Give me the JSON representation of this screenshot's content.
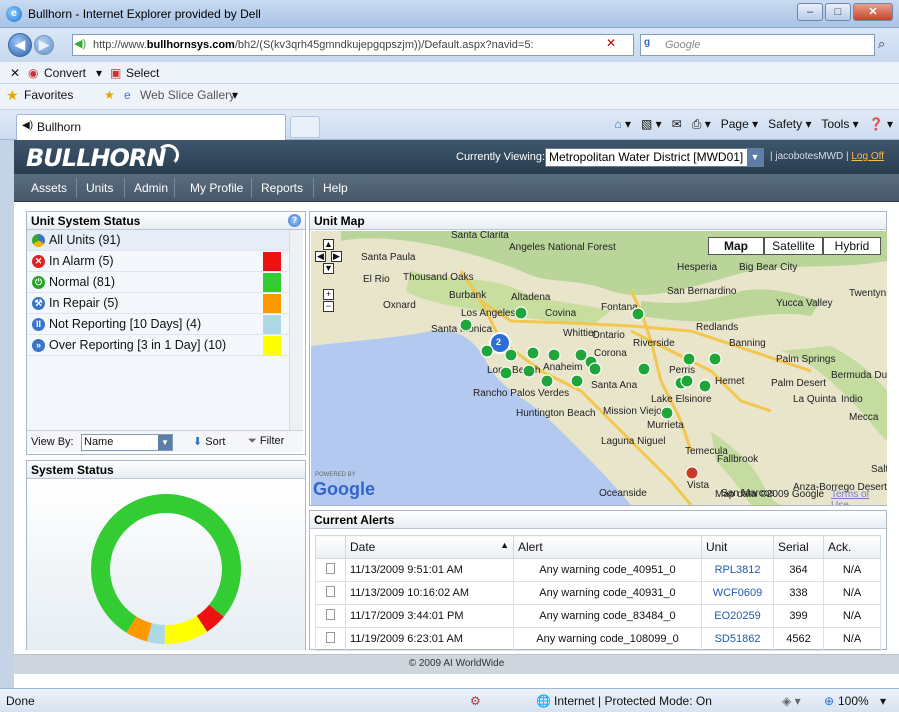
{
  "browser": {
    "title": "Bullhorn - Internet Explorer provided by Dell",
    "url_prefix": "http://www.",
    "url_domain": "bullhornsys.com",
    "url_rest": "/bh2/(S(kv3qrh45gmndkujepgqpszjm))/Default.aspx?navid=5:",
    "search_placeholder": "Google",
    "convert_label": "Convert",
    "select_label": "Select",
    "favorites_label": "Favorites",
    "webslice_label": "Web Slice Gallery",
    "tab_label": "Bullhorn",
    "cmd_page": "Page",
    "cmd_safety": "Safety",
    "cmd_tools": "Tools",
    "status_done": "Done",
    "status_zone": "Internet | Protected Mode: On",
    "zoom": "100%"
  },
  "app": {
    "logo": "BULLHORN",
    "viewing_label": "Currently Viewing:",
    "viewing_value": "Metropolitan Water District [MWD01]",
    "user": "jacobotesMWD",
    "logoff": "Log Off",
    "menu": [
      "Assets",
      "Units",
      "Admin",
      "My Profile",
      "Reports",
      "Help"
    ],
    "footer": "© 2009 AI WorldWide"
  },
  "unit_status": {
    "title": "Unit System Status",
    "rows": [
      {
        "label": "All Units (91)",
        "color": "",
        "icon": "all-units-icon"
      },
      {
        "label": "In Alarm (5)",
        "color": "#ee1111",
        "icon": "alarm-icon"
      },
      {
        "label": "Normal (81)",
        "color": "#33cc33",
        "icon": "power-icon"
      },
      {
        "label": "In Repair (5)",
        "color": "#ff9900",
        "icon": "wrench-icon"
      },
      {
        "label": "Not Reporting [10 Days] (4)",
        "color": "#add8e6",
        "icon": "pause-icon"
      },
      {
        "label": "Over Reporting [3 in 1 Day] (10)",
        "color": "#ffff00",
        "icon": "fast-forward-icon"
      }
    ],
    "view_by_label": "View By:",
    "view_by_value": "Name",
    "sort_label": "Sort",
    "filter_label": "Filter"
  },
  "system_status": {
    "title": "System Status",
    "donut": [
      {
        "name": "Normal",
        "value": 81,
        "color": "#33cc33"
      },
      {
        "name": "In Alarm",
        "value": 5,
        "color": "#ee1111"
      },
      {
        "name": "Over Reporting",
        "value": 10,
        "color": "#ffff00"
      },
      {
        "name": "Not Reporting",
        "value": 4,
        "color": "#add8e6"
      },
      {
        "name": "In Repair",
        "value": 5,
        "color": "#ff9900"
      }
    ]
  },
  "map": {
    "title": "Unit Map",
    "types": [
      "Map",
      "Satellite",
      "Hybrid"
    ],
    "copyright": "Map data ©2009 Google",
    "terms": "Terms of Use",
    "powered": "POWERED BY",
    "google": "Google",
    "cluster_count": "2",
    "places": [
      "Santa Clarita",
      "Angeles National Forest",
      "Hesperia",
      "Big Bear City",
      "Thousand Oaks",
      "El Rio",
      "Oxnard",
      "Burbank",
      "Los Angeles",
      "Altadena",
      "Covina",
      "Fontana",
      "San Bernardino",
      "Yucca Valley",
      "Twentynine Palms",
      "Redlands",
      "Santa Monica",
      "Whittier",
      "Ontario",
      "Riverside",
      "Banning",
      "Palm Springs",
      "Corona",
      "Anaheim",
      "Long Beach",
      "Santa Ana",
      "Perris",
      "Hemet",
      "Palm Desert",
      "Bermuda Dunes",
      "La Quinta",
      "Indio",
      "Rancho Palos Verdes",
      "Huntington Beach",
      "Mission Viejo",
      "Lake Elsinore",
      "Murrieta",
      "Mecca",
      "Laguna Niguel",
      "Temecula",
      "Fallbrook",
      "Oceanside",
      "Vista",
      "San Marcos",
      "Anza-Borrego Desert State",
      "Santa Paula",
      "Salton"
    ]
  },
  "alerts": {
    "title": "Current Alerts",
    "columns": [
      "Date",
      "Alert",
      "Unit",
      "Serial",
      "Ack."
    ],
    "rows": [
      {
        "date": "11/13/2009 9:51:01 AM",
        "alert": "Any warning code_40951_0",
        "unit": "RPL3812",
        "serial": "364",
        "ack": "N/A"
      },
      {
        "date": "11/13/2009 10:16:02 AM",
        "alert": "Any warning code_40931_0",
        "unit": "WCF0609",
        "serial": "338",
        "ack": "N/A"
      },
      {
        "date": "11/17/2009 3:44:01 PM",
        "alert": "Any warning code_83484_0",
        "unit": "EO20259",
        "serial": "399",
        "ack": "N/A"
      },
      {
        "date": "11/19/2009 6:23:01 AM",
        "alert": "Any warning code_108099_0",
        "unit": "SD51862",
        "serial": "4562",
        "ack": "N/A"
      }
    ]
  }
}
